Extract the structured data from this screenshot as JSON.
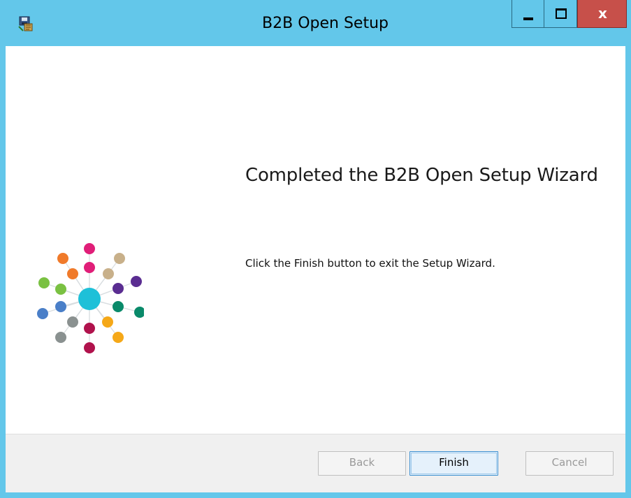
{
  "window": {
    "title": "B2B Open Setup",
    "title_bar_color": "#63c7ea",
    "close_color": "#c7504a"
  },
  "title_controls": {
    "minimize_icon": "minimize-icon",
    "maximize_icon": "maximize-icon",
    "close_label": "x"
  },
  "app_icon": "installer-icon",
  "wizard": {
    "heading": "Completed the B2B Open Setup Wizard",
    "message": "Click the Finish button to exit the Setup Wizard.",
    "graphic": "hub-network-logo"
  },
  "footer": {
    "back_label": "Back",
    "finish_label": "Finish",
    "cancel_label": "Cancel",
    "back_enabled": false,
    "cancel_enabled": false
  },
  "logo_colors": {
    "center": "#1ec0d8",
    "pink": "#e01e78",
    "tan": "#c8b08a",
    "purple": "#5a2d91",
    "green": "#0a8a6a",
    "yellow": "#f5a818",
    "maroon": "#b0124c",
    "gray": "#8a9190",
    "blue": "#4a7fc8",
    "lime": "#7ac142",
    "orange": "#f07a2a"
  }
}
